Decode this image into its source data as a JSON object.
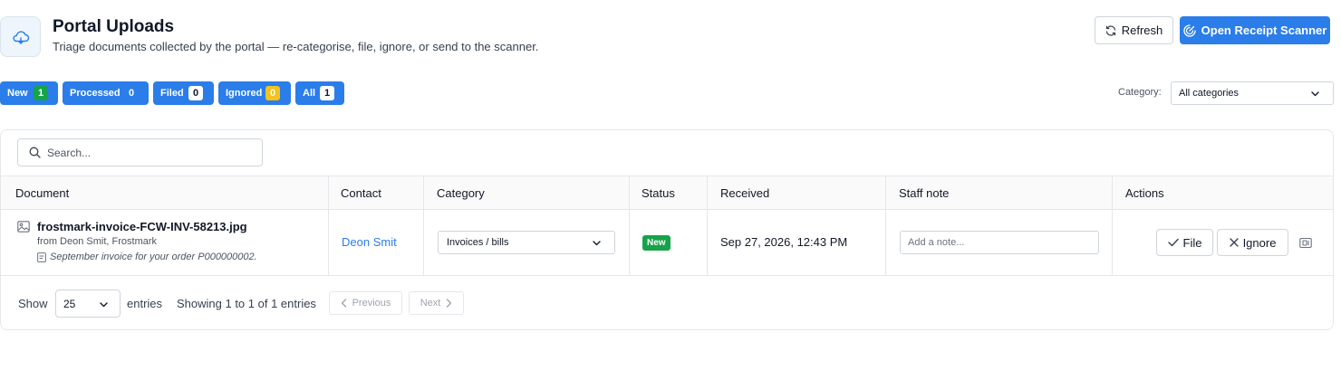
{
  "header": {
    "title": "Portal Uploads",
    "subtitle": "Triage documents collected by the portal — re-categorise, file, ignore, or send to the scanner.",
    "icon": "cloud-icon",
    "refresh_label": "Refresh",
    "scanner_label": "Open Receipt Scanner",
    "accent_color": "#2b7de9"
  },
  "tabs": [
    {
      "label": "New",
      "count": "1",
      "badge_color": "#16a34a"
    },
    {
      "label": "Processed",
      "count": "0",
      "badge_color": "#2b7de9"
    },
    {
      "label": "Filed",
      "count": "0",
      "badge_color": "#ffffff"
    },
    {
      "label": "Ignored",
      "count": "0",
      "badge_color": "#f6c21b"
    },
    {
      "label": "All",
      "count": "1",
      "badge_color": "#ffffff"
    }
  ],
  "category_filter": {
    "label": "Category:",
    "selected": "All categories"
  },
  "search": {
    "placeholder": "Search..."
  },
  "table": {
    "columns": [
      "Document",
      "Contact",
      "Category",
      "Status",
      "Received",
      "Staff note",
      "Actions"
    ],
    "rows": [
      {
        "document": "frostmark-invoice-FCW-INV-58213.jpg",
        "from": "from Deon Smit, Frostmark",
        "note": "September invoice for your order P000000002.",
        "contact": "Deon Smit",
        "category": "Invoices / bills",
        "status": "New",
        "received": "Sep 27, 2026, 12:43 PM",
        "staff_note_placeholder": "Add a note...",
        "file_label": "File",
        "ignore_label": "Ignore"
      }
    ]
  },
  "footer": {
    "show_label": "Show",
    "page_size": "25",
    "entries_label": "entries",
    "info": "Showing 1 to 1 of 1 entries",
    "previous_label": "Previous",
    "next_label": "Next"
  }
}
